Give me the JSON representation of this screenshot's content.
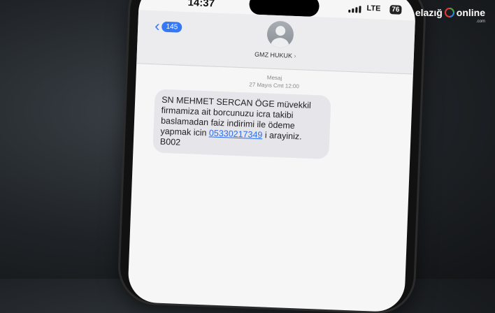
{
  "status_bar": {
    "time": "14:37",
    "network": "LTE",
    "battery": "76"
  },
  "header": {
    "back_count": "145",
    "contact_name": "GMZ HUKUK",
    "contact_chevron": "›"
  },
  "message_meta": {
    "label": "Mesaj",
    "timestamp": "27 Mayıs Cmt 12:00"
  },
  "message": {
    "text_before": "SN MEHMET SERCAN ÖGE müvekkil firmamiza ait borcunuzu icra takibi baslamadan faiz indirimi ile ödeme yapmak icin ",
    "phone": "05330217349",
    "text_after": " i arayiniz. B002"
  },
  "watermark": {
    "part1": "elazığ",
    "part2": "online",
    "sub": ".com"
  },
  "colors": {
    "accent": "#3478f6",
    "bubble": "#e5e5ea",
    "link": "#2a6cf0"
  },
  "icons": {
    "back": "chevron-left-icon",
    "avatar": "person-icon",
    "signal": "signal-bars-icon",
    "battery": "battery-icon"
  }
}
